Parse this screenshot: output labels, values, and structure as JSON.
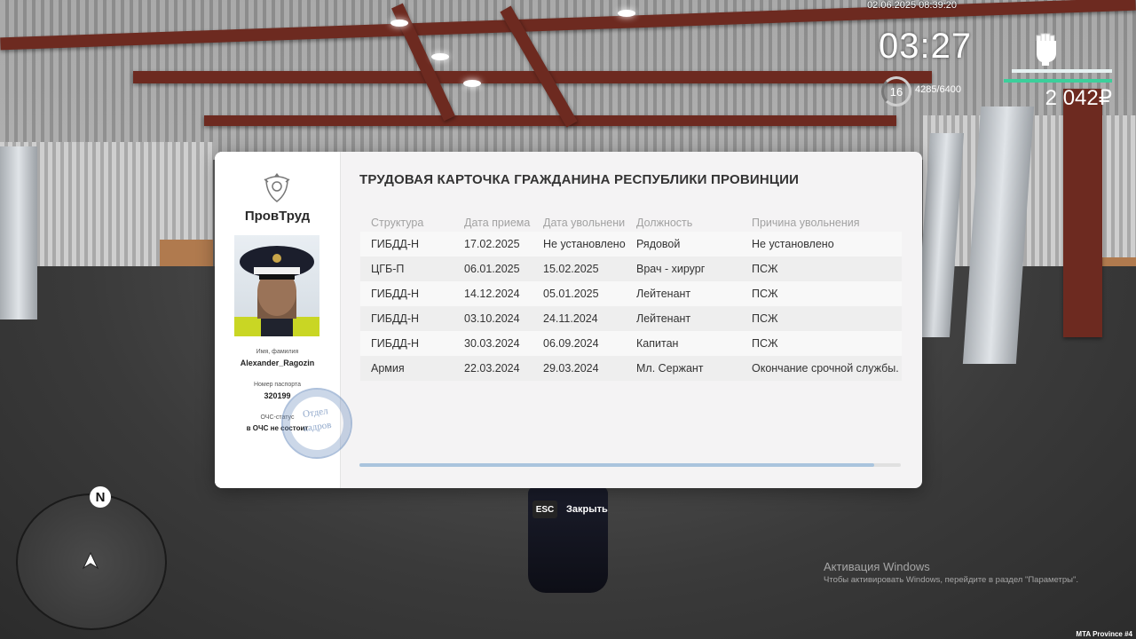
{
  "hud": {
    "datetime": "02.06.2025 08:39:20",
    "time": "03:27",
    "level": "16",
    "xp": "4285/6400",
    "money": "2 042₽",
    "fist_icon": "fist-icon",
    "colors": {
      "health": "#e7f2f2",
      "armor": "#3ccf9b"
    }
  },
  "card": {
    "brand": "ПровТруд",
    "title": "ТРУДОВАЯ КАРТОЧКА ГРАЖДАНИНА РЕСПУБЛИКИ ПРОВИНЦИИ",
    "name_label": "Имя, фамилия",
    "name": "Alexander_Ragozin",
    "passport_label": "Номер паспорта",
    "passport": "320199",
    "ochs_label": "ОЧС-статус",
    "ochs": "в ОЧС не состоит",
    "stamp_line1": "Отдел",
    "stamp_line2": "кадров",
    "columns": [
      "Структура",
      "Дата приема",
      "Дата увольнени",
      "Должность",
      "Причина увольнения"
    ],
    "rows": [
      [
        "ГИБДД-Н",
        "17.02.2025",
        "Не установлено",
        "Рядовой",
        "Не установлено"
      ],
      [
        "ЦГБ-П",
        "06.01.2025",
        "15.02.2025",
        "Врач - хирург",
        "ПСЖ"
      ],
      [
        "ГИБДД-Н",
        "14.12.2024",
        "05.01.2025",
        "Лейтенант",
        "ПСЖ"
      ],
      [
        "ГИБДД-Н",
        "03.10.2024",
        "24.11.2024",
        "Лейтенант",
        "ПСЖ"
      ],
      [
        "ГИБДД-Н",
        "30.03.2024",
        "06.09.2024",
        "Капитан",
        "ПСЖ"
      ],
      [
        "Армия",
        "22.03.2024",
        "29.03.2024",
        "Мл. Сержант",
        "Окончание срочной службы."
      ]
    ],
    "scroll_fraction": 0.95
  },
  "close": {
    "key": "ESC",
    "label": "Закрыть"
  },
  "minimap": {
    "north": "N"
  },
  "watermark": {
    "title": "Активация Windows",
    "subtitle": "Чтобы активировать Windows, перейдите в раздел \"Параметры\"."
  },
  "server": "MTA Province #4"
}
